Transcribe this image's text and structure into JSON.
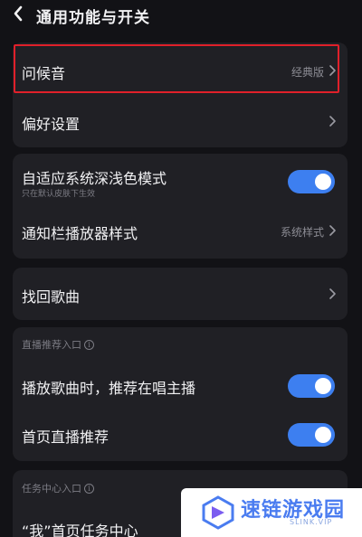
{
  "header": {
    "title": "通用功能与开关",
    "back_icon": "chevron-left-icon"
  },
  "card1": {
    "greeting": {
      "label": "问候音",
      "value": "经典版"
    },
    "preferences": {
      "label": "偏好设置"
    }
  },
  "card2": {
    "dark_mode": {
      "label": "自适应系统深浅色模式",
      "sublabel": "只在默认皮肤下生效",
      "enabled": true
    },
    "notification_player": {
      "label": "通知栏播放器样式",
      "value": "系统样式"
    }
  },
  "card3": {
    "recover_songs": {
      "label": "找回歌曲"
    }
  },
  "card4": {
    "section_title": "直播推荐入口",
    "recommend_while_playing": {
      "label": "播放歌曲时，推荐在唱主播",
      "enabled": true
    },
    "home_live": {
      "label": "首页直播推荐",
      "enabled": true
    }
  },
  "card5": {
    "section_title": "任务中心入口",
    "home_task": {
      "label": "“我”首页任务中心"
    }
  },
  "watermark": {
    "name": "速链游戏园",
    "domain": "SLINK.VIP"
  },
  "colors": {
    "background": "#121216",
    "card": "#202025",
    "toggle_on": "#3d7ff0",
    "highlight": "#e0202a"
  }
}
